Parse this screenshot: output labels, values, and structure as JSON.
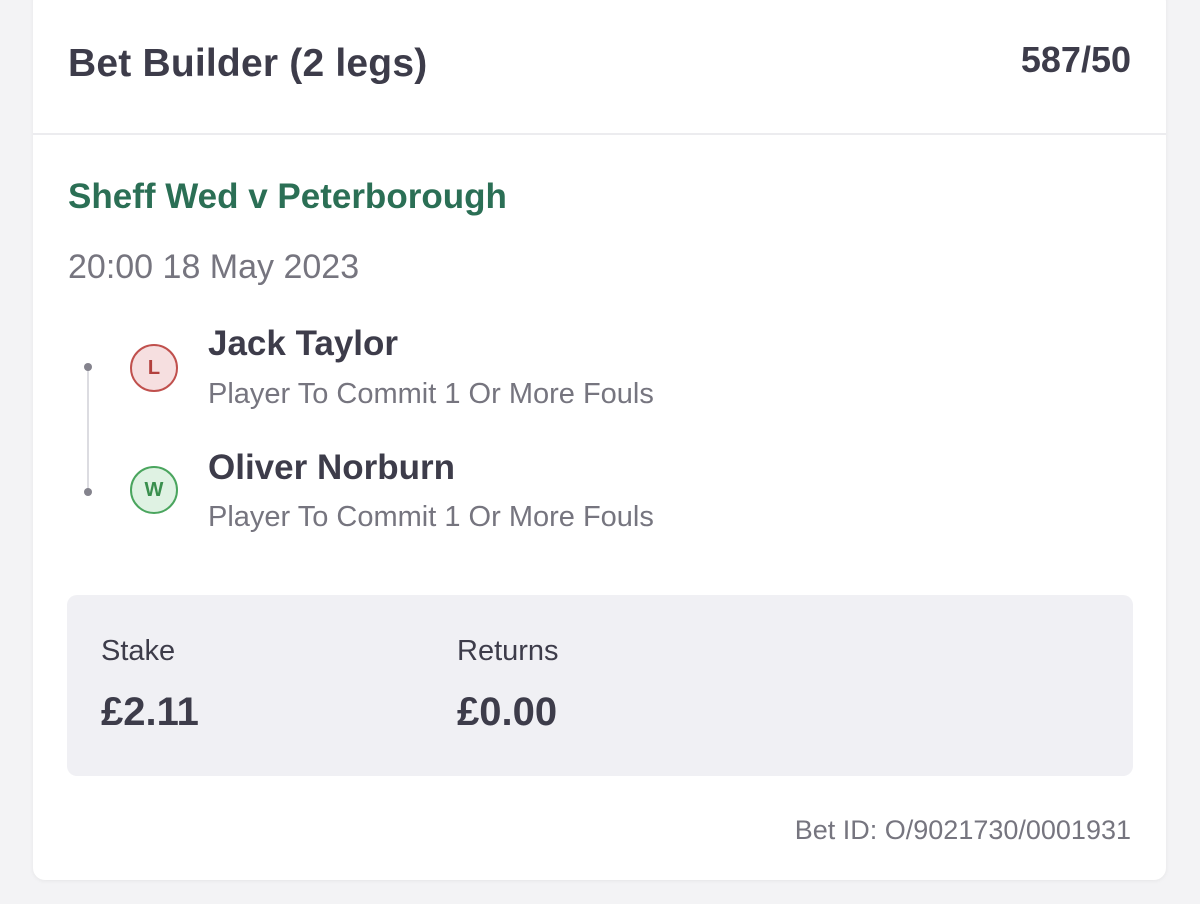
{
  "bet": {
    "title": "Bet Builder (2 legs)",
    "odds": "587/50"
  },
  "event": {
    "name": "Sheff Wed v Peterborough",
    "datetime": "20:00 18 May 2023"
  },
  "legs": [
    {
      "result_badge": "L",
      "result": "lose",
      "player": "Jack Taylor",
      "market": "Player To Commit 1 Or More Fouls"
    },
    {
      "result_badge": "W",
      "result": "win",
      "player": "Oliver Norburn",
      "market": "Player To Commit 1 Or More Fouls"
    }
  ],
  "summary": {
    "stake_label": "Stake",
    "stake_value": "£2.11",
    "returns_label": "Returns",
    "returns_value": "£0.00"
  },
  "footer": {
    "bet_id": "Bet ID: O/9021730/0001931"
  },
  "colors": {
    "event_green": "#2b6f55",
    "lose_red": "#c0504d",
    "win_green": "#4aa55e",
    "text_dark": "#3d3c4a",
    "text_muted": "#76757f"
  }
}
